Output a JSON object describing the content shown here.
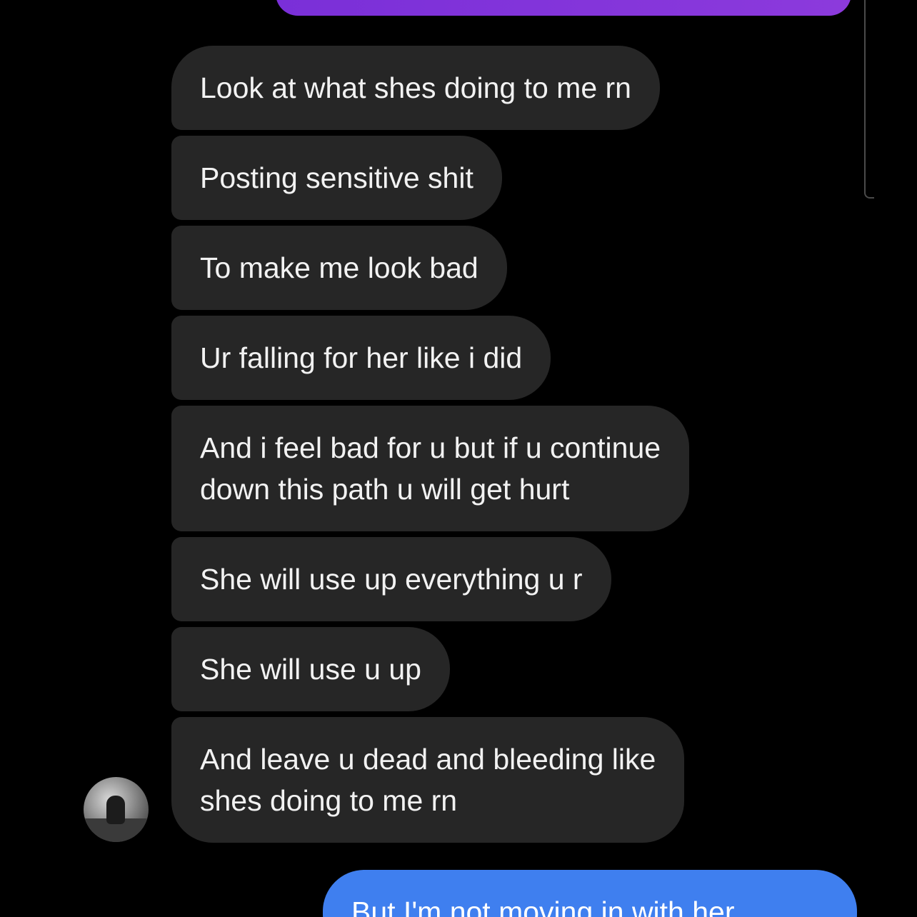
{
  "conversation": {
    "received_messages": [
      {
        "text": "Look at what shes doing to me rn"
      },
      {
        "text": "Posting sensitive shit"
      },
      {
        "text": "To make me look bad"
      },
      {
        "text": "Ur falling for her like i did"
      },
      {
        "text": "And i feel bad for u but if u continue\ndown this path u will get hurt"
      },
      {
        "text": "She will use up everything u r"
      },
      {
        "text": "She will use u up"
      },
      {
        "text": "And leave u dead and bleeding like\nshes doing to me rn"
      }
    ],
    "sent_message": {
      "text": "But I'm not moving in with her"
    }
  },
  "colors": {
    "background": "#000000",
    "received_bubble": "#262626",
    "sent_bubble": "#3f7fef",
    "top_sent_bubble": "#7a2fd8"
  },
  "icons": {
    "avatar": "sender-avatar"
  }
}
